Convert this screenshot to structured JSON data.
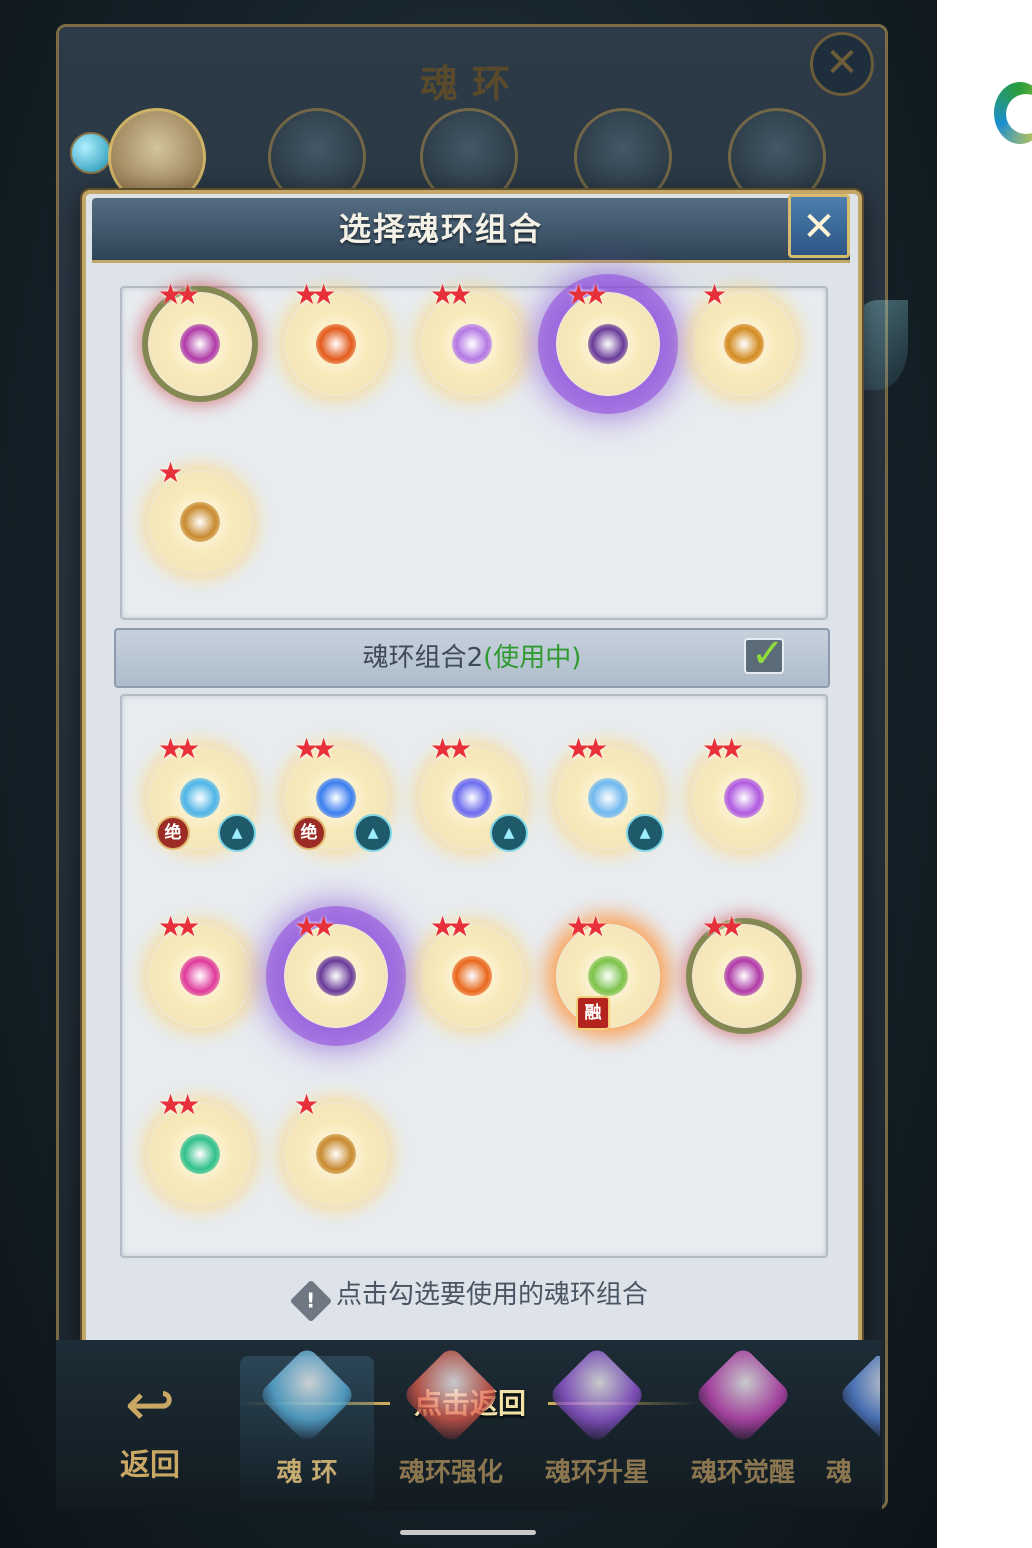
{
  "background": {
    "title": "魂环",
    "close_icon": "close-icon"
  },
  "modal": {
    "title": "选择魂环组合",
    "close_icon": "close-icon",
    "combo_label_prefix": "魂环组合2",
    "combo_status": "(使用中)",
    "combo_checked": true,
    "hint_icon": "exclamation-icon",
    "hint_text": "点击勾选要使用的魂环组合",
    "colors": {
      "accent_gold": "#c2a766",
      "in_use_green": "#2f9a2f",
      "star_red": "#e8303a"
    }
  },
  "combo1_rings": [
    {
      "stars": 2,
      "aura": "thorn",
      "core": "#b03aa8"
    },
    {
      "stars": 2,
      "aura": "glow",
      "core": "#e45a1c"
    },
    {
      "stars": 2,
      "aura": "glow",
      "core": "#b477e6"
    },
    {
      "stars": 2,
      "aura": "purple",
      "core": "#6a3a9a"
    },
    {
      "stars": 1,
      "aura": "glow",
      "core": "#d48a22"
    },
    {
      "stars": 1,
      "aura": "glow",
      "core": "#c88a30"
    }
  ],
  "combo2_rings": [
    {
      "stars": 2,
      "aura": "glow",
      "core": "#4db4e8",
      "badge": "绝",
      "upgrade": true
    },
    {
      "stars": 2,
      "aura": "glow",
      "core": "#3a7ef0",
      "badge": "绝",
      "upgrade": true
    },
    {
      "stars": 2,
      "aura": "glow",
      "core": "#6c6cf0",
      "upgrade": true
    },
    {
      "stars": 2,
      "aura": "glow",
      "core": "#6fb8ef",
      "upgrade": true
    },
    {
      "stars": 2,
      "aura": "glow",
      "core": "#b05ae0"
    },
    {
      "stars": 2,
      "aura": "glow",
      "core": "#e03a9a"
    },
    {
      "stars": 2,
      "aura": "purple",
      "core": "#6a3a9a"
    },
    {
      "stars": 2,
      "aura": "glow",
      "core": "#e8661c"
    },
    {
      "stars": 2,
      "aura": "fire",
      "core": "#7cc24a",
      "badge_rong": "融"
    },
    {
      "stars": 2,
      "aura": "thorn",
      "core": "#b03aa8"
    },
    {
      "stars": 2,
      "aura": "glow",
      "core": "#2fc08a"
    },
    {
      "stars": 1,
      "aura": "glow",
      "core": "#c88a30"
    }
  ],
  "bottom": {
    "back_label": "返回",
    "tap_return": "点击返回",
    "tabs": [
      {
        "label": "魂 环",
        "active": true,
        "gem": "#5ab4e0"
      },
      {
        "label": "魂环强化",
        "active": false,
        "gem": "#e05a4a"
      },
      {
        "label": "魂环升星",
        "active": false,
        "gem": "#9a5ae0"
      },
      {
        "label": "魂环觉醒",
        "active": false,
        "gem": "#d04ac0"
      },
      {
        "label": "魂",
        "active": false,
        "gem": "#5a8ae0"
      }
    ]
  }
}
